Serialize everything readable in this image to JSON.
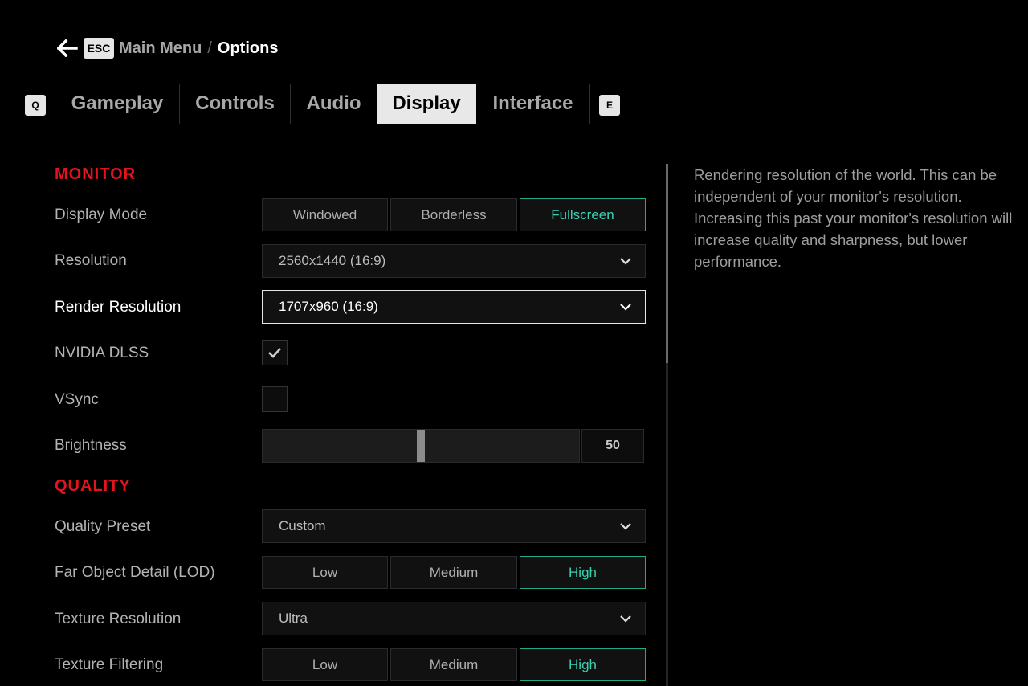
{
  "breadcrumb": {
    "esc_key": "ESC",
    "parent": "Main Menu",
    "separator": "/",
    "current": "Options"
  },
  "tabs": {
    "prev_key": "Q",
    "next_key": "E",
    "items": [
      {
        "label": "Gameplay"
      },
      {
        "label": "Controls"
      },
      {
        "label": "Audio"
      },
      {
        "label": "Display",
        "active": true
      },
      {
        "label": "Interface"
      }
    ]
  },
  "sections": {
    "monitor": {
      "title": "MONITOR",
      "display_mode": {
        "label": "Display Mode",
        "options": [
          "Windowed",
          "Borderless",
          "Fullscreen"
        ],
        "selected": "Fullscreen"
      },
      "resolution": {
        "label": "Resolution",
        "value": "2560x1440 (16:9)"
      },
      "render_resolution": {
        "label": "Render Resolution",
        "value": "1707x960 (16:9)"
      },
      "nvidia_dlss": {
        "label": "NVIDIA DLSS",
        "checked": true
      },
      "vsync": {
        "label": "VSync",
        "checked": false
      },
      "brightness": {
        "label": "Brightness",
        "value": "50",
        "fraction": 0.5
      }
    },
    "quality": {
      "title": "QUALITY",
      "quality_preset": {
        "label": "Quality Preset",
        "value": "Custom"
      },
      "far_object_detail": {
        "label": "Far Object Detail (LOD)",
        "options": [
          "Low",
          "Medium",
          "High"
        ],
        "selected": "High"
      },
      "texture_resolution": {
        "label": "Texture Resolution",
        "value": "Ultra"
      },
      "texture_filtering": {
        "label": "Texture Filtering",
        "options": [
          "Low",
          "Medium",
          "High"
        ],
        "selected": "High"
      }
    }
  },
  "description": "Rendering resolution of the world. This can be independent of your monitor's resolution. Increasing this past your monitor's resolution will increase quality and sharpness, but lower performance.",
  "colors": {
    "background": "#000000",
    "section_title": "#e2141c",
    "selected_accent": "#3ad1b2",
    "active_tab_bg": "#e8e8e8"
  },
  "icons": {
    "back": "arrow-left-icon",
    "dropdown": "chevron-down-icon",
    "check": "checkmark-icon"
  }
}
